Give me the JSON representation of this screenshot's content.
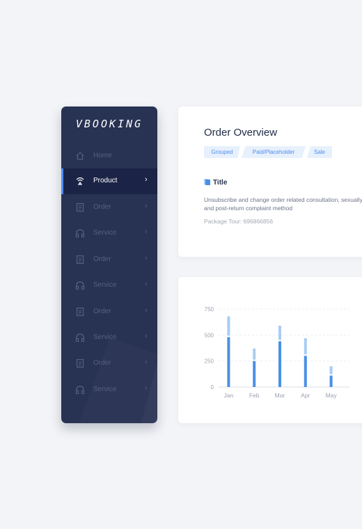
{
  "brand": {
    "logo": "VBOOKING"
  },
  "sidebar": {
    "items": [
      {
        "label": "Home",
        "icon": "home-icon",
        "chevron": "",
        "active": false
      },
      {
        "label": "Product",
        "icon": "broadcast-icon",
        "chevron": "›",
        "active": true
      },
      {
        "label": "Order",
        "icon": "document-icon",
        "chevron": "›",
        "active": false
      },
      {
        "label": "Service",
        "icon": "headphones-icon",
        "chevron": "›",
        "active": false
      },
      {
        "label": "Order",
        "icon": "document-icon",
        "chevron": "›",
        "active": false
      },
      {
        "label": "Service",
        "icon": "headphones-icon",
        "chevron": "›",
        "active": false
      },
      {
        "label": "Order",
        "icon": "document-icon",
        "chevron": "›",
        "active": false
      },
      {
        "label": "Service",
        "icon": "headphones-icon",
        "chevron": "›",
        "active": false
      },
      {
        "label": "Order",
        "icon": "document-icon",
        "chevron": "›",
        "active": false
      },
      {
        "label": "Service",
        "icon": "headphones-icon",
        "chevron": "›",
        "active": false
      }
    ]
  },
  "overview": {
    "title": "Order Overview",
    "tags": [
      "Grouped",
      "Paid/Placeholder",
      "Sale"
    ],
    "section_title": "Title",
    "description": "Unsubscribe and change order related consultation, sexually, and post-return complaint method",
    "package_tour": "Package Tour:  696866856"
  },
  "colors": {
    "accent": "#4f8cf7",
    "bar_dark": "#4a90e6",
    "bar_light": "#a9cdf2",
    "sidebar_bg": "#283252"
  },
  "chart_data": {
    "type": "bar",
    "categories": [
      "Jan",
      "Feb",
      "Mar",
      "Apr",
      "May"
    ],
    "series": [
      {
        "values": [
          480,
          250,
          440,
          300,
          110
        ]
      },
      {
        "values": [
          680,
          370,
          590,
          470,
          200
        ]
      }
    ],
    "stacked_overlay": true,
    "yticks": [
      0,
      250,
      500,
      750
    ],
    "ylim": [
      0,
      750
    ],
    "grid": true
  }
}
